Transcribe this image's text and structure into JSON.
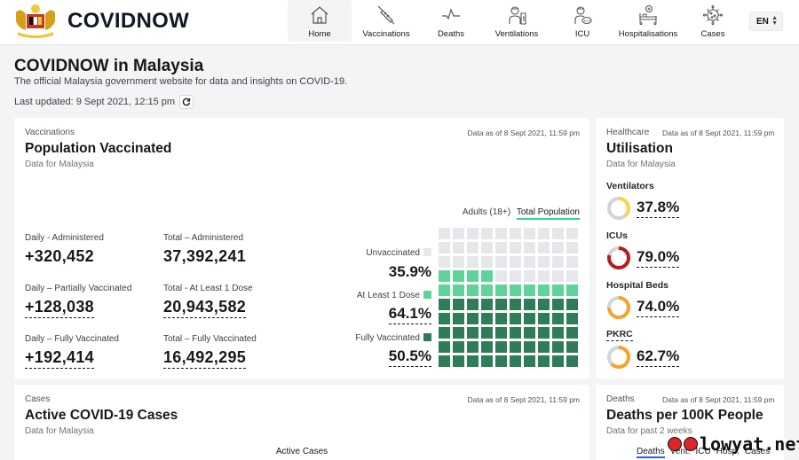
{
  "header": {
    "brand": "COVIDNOW",
    "nav": [
      {
        "label": "Home",
        "icon": "home-icon",
        "active": true
      },
      {
        "label": "Vaccinations",
        "icon": "syringe-icon"
      },
      {
        "label": "Deaths",
        "icon": "pulse-icon"
      },
      {
        "label": "Ventilations",
        "icon": "ventilator-icon"
      },
      {
        "label": "ICU",
        "icon": "icu-icon"
      },
      {
        "label": "Hospitalisations",
        "icon": "hospital-bed-icon"
      },
      {
        "label": "Cases",
        "icon": "virus-icon"
      }
    ],
    "language": "EN"
  },
  "page": {
    "title": "COVIDNOW in Malaysia",
    "subtitle": "The official Malaysia government website for data and insights on COVID-19.",
    "last_updated": "Last updated: 9 Sept 2021, 12:15 pm"
  },
  "vaccinations": {
    "kicker": "Vaccinations",
    "as_of": "Data as of 8 Sept 2021, 11:59 pm",
    "title": "Population Vaccinated",
    "subtitle": "Data for Malaysia",
    "toggle": {
      "option_a": "Adults (18+)",
      "option_b": "Total Population",
      "selected": "Total Population"
    },
    "stats": [
      {
        "label": "Daily - Administered",
        "value": "+320,452"
      },
      {
        "label": "Total – Administered",
        "value": "37,392,241"
      },
      {
        "label": "Daily – Partially Vaccinated",
        "value": "+128,038"
      },
      {
        "label": "Total - At Least 1 Dose",
        "value": "20,943,582"
      },
      {
        "label": "Daily – Fully Vaccinated",
        "value": "+192,414"
      },
      {
        "label": "Total – Fully Vaccinated",
        "value": "16,492,295"
      }
    ],
    "waffle": {
      "legend": [
        {
          "label": "Unvaccinated",
          "pct": "35.9%",
          "color": "#e5e7eb",
          "cells": 36
        },
        {
          "label": "At Least 1 Dose",
          "pct": "64.1%",
          "color": "#5fd39a",
          "cells": 14
        },
        {
          "label": "Fully Vaccinated",
          "pct": "50.5%",
          "color": "#2e7d57",
          "cells": 50
        }
      ]
    }
  },
  "utilisation": {
    "kicker": "Healthcare",
    "as_of": "Data as of 8 Sept 2021, 11:59 pm",
    "title": "Utilisation",
    "subtitle": "Data for Malaysia",
    "items": [
      {
        "label": "Ventilators",
        "value": "37.8%",
        "fraction": 0.378,
        "color": "#fcd34d"
      },
      {
        "label": "ICUs",
        "value": "79.0%",
        "fraction": 0.79,
        "color": "#b91c1c"
      },
      {
        "label": "Hospital Beds",
        "value": "74.0%",
        "fraction": 0.74,
        "color": "#f5a524"
      },
      {
        "label": "PKRC",
        "value": "62.7%",
        "fraction": 0.627,
        "color": "#f5a524"
      }
    ]
  },
  "cases": {
    "kicker": "Cases",
    "as_of": "Data as of 8 Sept 2021, 11:59 pm",
    "title": "Active COVID-19 Cases",
    "subtitle": "Data for Malaysia",
    "chart_title": "Active Cases"
  },
  "deaths": {
    "kicker": "Deaths",
    "as_of": "Data as of 8 Sept 2021, 11:59 pm",
    "title": "Deaths per 100K People",
    "subtitle": "Data for past 2 weeks",
    "tabs": [
      "Deaths",
      "Vent.",
      "ICU",
      "Hosp.",
      "Cases"
    ],
    "selected_tab": "Deaths"
  },
  "watermark": "lowyat.net"
}
